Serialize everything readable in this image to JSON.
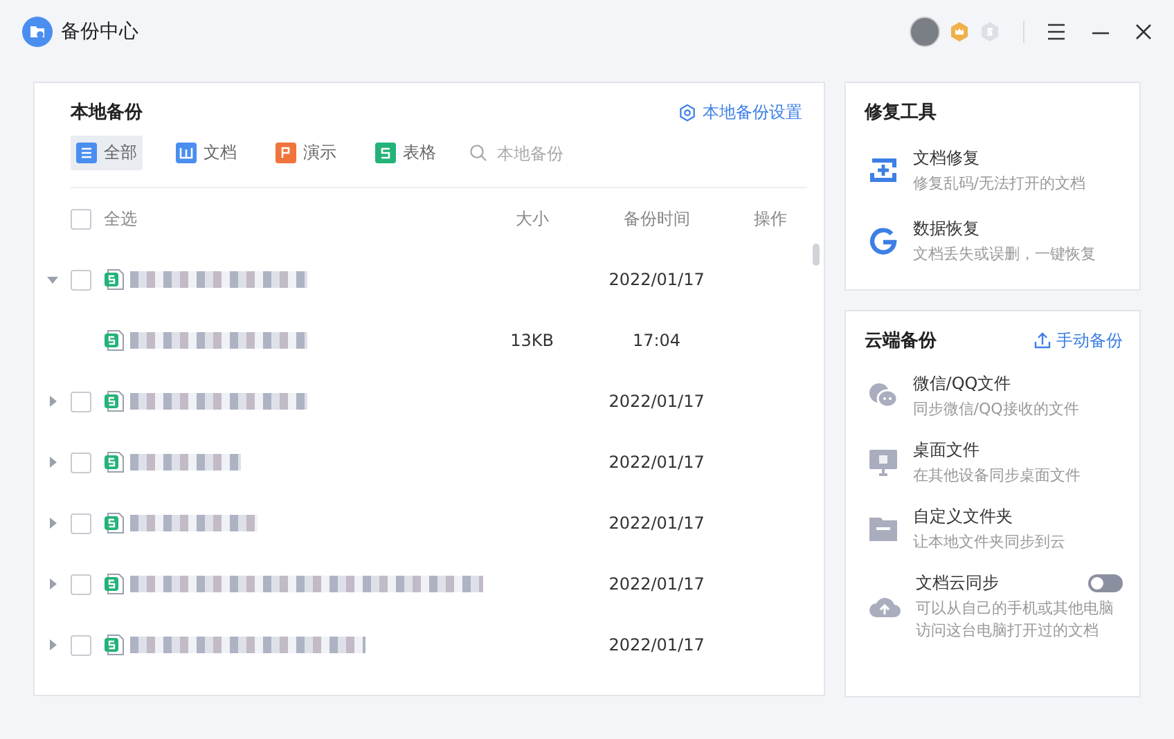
{
  "window": {
    "title": "备份中心"
  },
  "local_backup": {
    "title": "本地备份",
    "settings_link": "本地备份设置",
    "filters": [
      {
        "kind": "all",
        "label": "全部",
        "selected": true
      },
      {
        "kind": "doc",
        "label": "文档",
        "selected": false
      },
      {
        "kind": "ppt",
        "label": "演示",
        "selected": false
      },
      {
        "kind": "sheet",
        "label": "表格",
        "selected": false
      }
    ],
    "search": {
      "placeholder": "本地备份"
    },
    "table": {
      "select_all": {
        "label": "全选",
        "checked": false
      },
      "columns": [
        "大小",
        "备份时间",
        "操作"
      ],
      "rows": [
        {
          "checked": false,
          "expanded": true,
          "size": "",
          "time": "2022/01/17",
          "children": [
            {
              "size": "13KB",
              "time": "17:04"
            }
          ]
        },
        {
          "checked": false,
          "expanded": false,
          "size": "",
          "time": "2022/01/17"
        },
        {
          "checked": false,
          "expanded": false,
          "size": "",
          "time": "2022/01/17"
        },
        {
          "checked": false,
          "expanded": false,
          "size": "",
          "time": "2022/01/17"
        },
        {
          "checked": false,
          "expanded": false,
          "size": "",
          "time": "2022/01/17"
        },
        {
          "checked": false,
          "expanded": false,
          "size": "",
          "time": "2022/01/17"
        }
      ]
    }
  },
  "repair_tools": {
    "title": "修复工具",
    "items": [
      {
        "kind": "repair",
        "title": "文档修复",
        "desc": "修复乱码/无法打开的文档"
      },
      {
        "kind": "recover",
        "title": "数据恢复",
        "desc": "文档丢失或误删，一键恢复"
      }
    ]
  },
  "cloud_backup": {
    "title": "云端备份",
    "manual_button": "手动备份",
    "items": [
      {
        "kind": "chat",
        "title": "微信/QQ文件",
        "desc": "同步微信/QQ接收的文件"
      },
      {
        "kind": "desktop",
        "title": "桌面文件",
        "desc": "在其他设备同步桌面文件"
      },
      {
        "kind": "folder",
        "title": "自定义文件夹",
        "desc": "让本地文件夹同步到云"
      },
      {
        "kind": "cloud",
        "title": "文档云同步",
        "desc": "可以从自己的手机或其他电脑访问这台电脑打开过的文档",
        "toggle": {
          "on": false
        }
      }
    ]
  }
}
